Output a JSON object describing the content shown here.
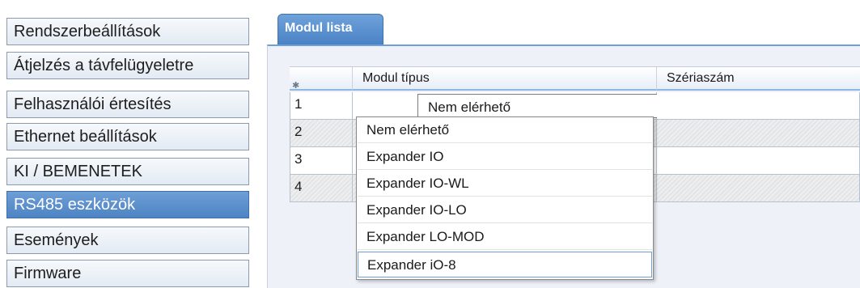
{
  "sidebar": {
    "items": [
      {
        "label": "Rendszerbeállítások",
        "active": false
      },
      {
        "label": "Átjelzés a távfelügyeletre",
        "active": false
      },
      {
        "label": "Felhasználói értesítés",
        "active": false
      },
      {
        "label": "Ethernet beállítások",
        "active": false
      },
      {
        "label": "KI / BEMENETEK",
        "active": false
      },
      {
        "label": "RS485 eszközök",
        "active": true
      },
      {
        "label": "Események",
        "active": false
      },
      {
        "label": "Firmware",
        "active": false
      }
    ]
  },
  "tab": {
    "label": "Modul lista"
  },
  "grid": {
    "columns": [
      "Modul típus",
      "Szériaszám"
    ],
    "header_icon": "asterisk-icon",
    "rows": [
      {
        "index": "1",
        "module": "Nem elérhető",
        "serial": ""
      },
      {
        "index": "2",
        "module": "",
        "serial": ""
      },
      {
        "index": "3",
        "module": "",
        "serial": ""
      },
      {
        "index": "4",
        "module": "",
        "serial": ""
      }
    ]
  },
  "dropdown": {
    "icon": "chevron-down-icon",
    "options": [
      "Nem elérhető",
      "Expander IO",
      "Expander IO-WL",
      "Expander IO-LO",
      "Expander LO-MOD",
      "Expander iO-8"
    ],
    "highlighted": "Expander iO-8"
  },
  "colors": {
    "accent": "#4e84c4",
    "tab": "#5a8fcd",
    "panel": "#eef2f8"
  }
}
